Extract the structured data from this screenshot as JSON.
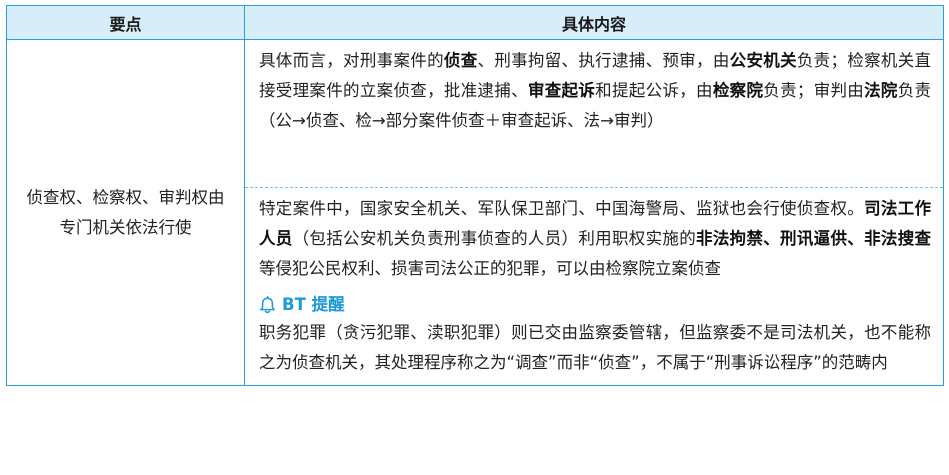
{
  "header": {
    "col1": "要点",
    "col2": "具体内容"
  },
  "left_cell": {
    "text": "侦查权、检察权、审判权由专门机关依法行使"
  },
  "row1": {
    "t1": "具体而言，对刑事案件的",
    "b1": "侦查",
    "t2": "、刑事拘留、执行逮捕、预审，由",
    "b2": "公安机关",
    "t3": "负责；检察机关直接受理案件的立案侦查，批准逮捕、",
    "b3": "审查起诉",
    "t4": "和提起公诉，由",
    "b4": "检察院",
    "t5": "负责；审判由",
    "b5": "法院",
    "t6": "负责（公→侦查、检→部分案件侦查＋审查起诉、法→审判）"
  },
  "row2": {
    "t1": "特定案件中，国家安全机关、军队保卫部门、中国海警局、监狱也会行使侦查权。",
    "b1": "司法工作人员",
    "t2": "（包括公安机关负责刑事侦查的人员）利用职权实施的",
    "b2": "非法拘禁、刑讯逼供、非法搜查",
    "t3": "等侵犯公民权利、损害司法公正的犯罪，可以由检察院立案侦查",
    "tip_title": "BT 提醒",
    "tip_icon": "bell-icon",
    "tip_text": "职务犯罪（贪污犯罪、渎职犯罪）则已交由监察委管辖，但监察委不是司法机关，也不能称之为侦查机关，其处理程序称之为“调查”而非“侦查”，不属于“刑事诉讼程序”的范畴内"
  },
  "colors": {
    "border": "#2a9fd8",
    "header_bg": "#d7edf9",
    "accent": "#1d9ad6"
  }
}
